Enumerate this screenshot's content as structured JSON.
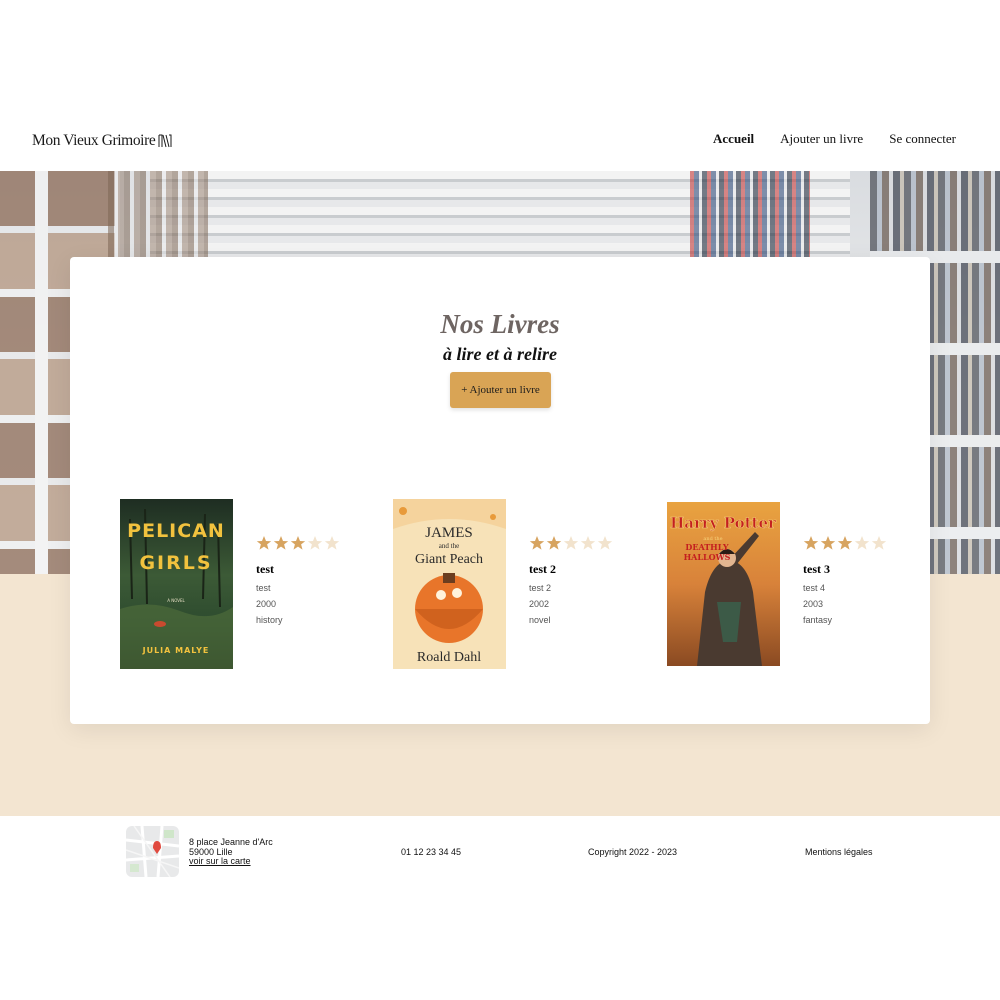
{
  "header": {
    "logo_text": "Mon Vieux Grimoire",
    "nav": [
      {
        "label": "Accueil",
        "active": true
      },
      {
        "label": "Ajouter un livre",
        "active": false
      },
      {
        "label": "Se connecter",
        "active": false
      }
    ]
  },
  "main": {
    "title": "Nos Livres",
    "subtitle": "à lire et à relire",
    "add_button": "+ Ajouter un livre",
    "books": [
      {
        "title": "test",
        "author": "test",
        "year": "2000",
        "genre": "history",
        "rating": 3,
        "max_rating": 5,
        "cover": {
          "title_lines": [
            "PELICAN",
            "GIRLS"
          ],
          "tag": "A NOVEL",
          "author": "JULIA MALYE"
        }
      },
      {
        "title": "test 2",
        "author": "test 2",
        "year": "2002",
        "genre": "novel",
        "rating": 2,
        "max_rating": 5,
        "cover": {
          "title_lines": [
            "JAMES",
            "and the",
            "Giant Peach"
          ],
          "author": "Roald Dahl"
        }
      },
      {
        "title": "test 3",
        "author": "test 4",
        "year": "2003",
        "genre": "fantasy",
        "rating": 3,
        "max_rating": 5,
        "cover": {
          "title_lines": [
            "Harry Potter",
            "and the",
            "DEATHLY",
            "HALLOWS"
          ]
        }
      }
    ]
  },
  "footer": {
    "address_line1": "8 place Jeanne d'Arc",
    "address_line2": "59000 Lille",
    "map_link": "voir sur la carte",
    "phone": "01 12 23 34 45",
    "copyright": "Copyright 2022 - 2023",
    "legal": "Mentions légales"
  },
  "colors": {
    "accent": "#d9a455",
    "star_filled": "#d7a460",
    "star_empty": "#f2e3cd",
    "floor_band": "#f3e5d1",
    "title_gray": "#6e6562"
  }
}
